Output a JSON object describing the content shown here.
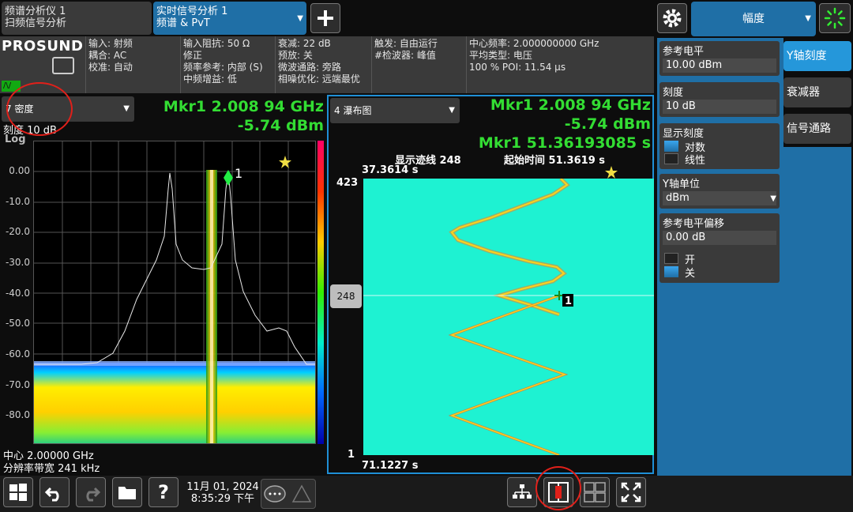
{
  "tabs": {
    "tab1_line1": "频谱分析仪 1",
    "tab1_line2": "扫频信号分析",
    "tab2_line1": "实时信号分析 1",
    "tab2_line2": "频谱 & PvT"
  },
  "menu": {
    "title": "幅度"
  },
  "logo": "PROSUND",
  "info_bar": {
    "col1": [
      "输入: 射频",
      "耦合: AC",
      "校准: 自动"
    ],
    "col2": [
      "输入阻抗: 50 Ω",
      "修正",
      "频率参考: 内部 (S)",
      "中频增益: 低"
    ],
    "col3": [
      "衰减: 22 dB",
      "预放: 关",
      "微波通路: 旁路",
      "相噪优化: 远端最优"
    ],
    "col4": [
      "触发: 自由运行",
      "#检波器: 峰值"
    ],
    "col5": [
      "中心频率: 2.000000000 GHz",
      "平均类型: 电压",
      "100 % POI: 11.54 µs"
    ]
  },
  "left_window": {
    "selector": "7 密度",
    "scale": "刻度 10 dB",
    "log": "Log",
    "mkr_freq": "Mkr1  2.008 94 GHz",
    "mkr_amp": "-5.74 dBm",
    "y_ticks": [
      "0.00",
      "-10.0",
      "-20.0",
      "-30.0",
      "-40.0",
      "-50.0",
      "-60.0",
      "-70.0",
      "-80.0"
    ],
    "marker_label": "1",
    "center": "中心 2.00000 GHz",
    "rbw": "分辨率带宽 241 kHz"
  },
  "right_window": {
    "selector": "4 瀑布图",
    "mkr_freq": "Mkr1  2.008 94 GHz",
    "mkr_amp": "-5.74 dBm",
    "mkr_time": "Mkr1 51.36193085 s",
    "trace_label": "显示迹线 248",
    "start_time": "起始时间 51.3619 s",
    "top_time": "37.3614 s",
    "y_top": "423",
    "y_bottom": "1",
    "trace_box": "248",
    "bottom_time": "71.1227 s",
    "marker_label": "1"
  },
  "side_menu": {
    "ref_level_title": "参考电平",
    "ref_level_value": "10.00 dBm",
    "scale_title": "刻度",
    "scale_value": "10 dB",
    "display_scale_title": "显示刻度",
    "opt_log": "对数",
    "opt_linear": "线性",
    "y_unit_title": "Y轴单位",
    "y_unit_value": "dBm",
    "ref_offset_title": "参考电平偏移",
    "ref_offset_value": "0.00 dB",
    "opt_on": "开",
    "opt_off": "关"
  },
  "side_tabs": [
    "Y轴刻度",
    "衰减器",
    "信号通路"
  ],
  "bottom": {
    "date": "11月 01, 2024",
    "time": "8:35:29 下午"
  },
  "colors": {
    "accent": "#1f6fa6",
    "marker_green": "#33dd33",
    "waterfall_bg": "#1ef2d2",
    "highlight_red": "#e0201a"
  }
}
